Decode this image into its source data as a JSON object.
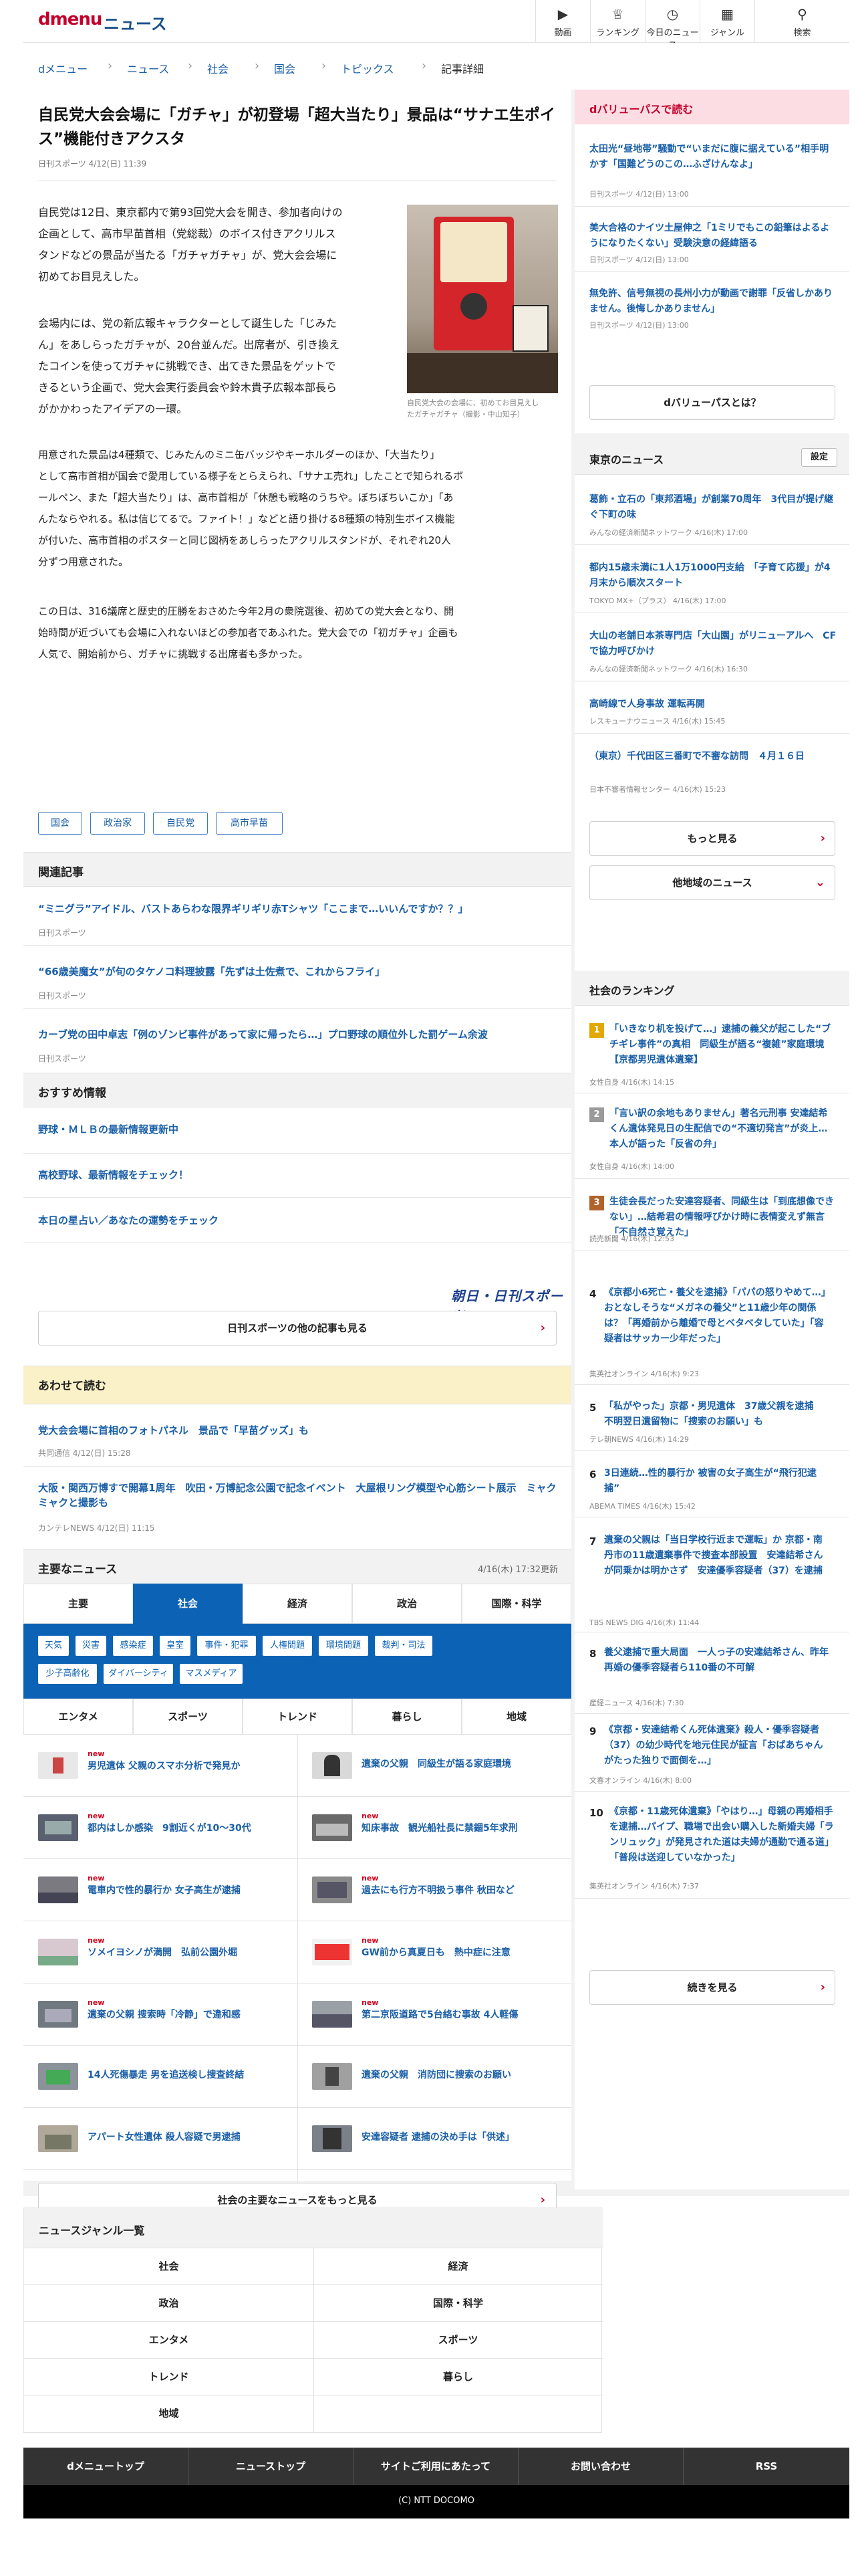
{
  "header": {
    "logo": "dmenu",
    "section": "ニュース",
    "nav": [
      {
        "icon": "video-icon",
        "label": "動画"
      },
      {
        "icon": "crown-icon",
        "label": "ランキング"
      },
      {
        "icon": "clock-icon",
        "label": "今日のニュース"
      },
      {
        "icon": "grid-icon",
        "label": "ジャンル"
      },
      {
        "icon": "search-icon",
        "label": "検索"
      }
    ]
  },
  "breadcrumb": [
    "dメニュー",
    "ニュース",
    "社会",
    "国会",
    "トピックス",
    "記事詳細"
  ],
  "article": {
    "title": "自民党大会会場に「ガチャ」が初登場「超大当たり」景品は“サナエ生ポイス”機能付きアクスタ",
    "meta": "日刊スポーツ 4/12(日) 11:39",
    "paragraphs": [
      [
        "自民党は12日、東京都内で第93回党大会を開き、参加者向けの",
        "企画として、高市早苗首相（党総裁）のボイス付きアクリルス",
        "タンドなどの景品が当たる「ガチャガチャ」が、党大会会場に",
        "初めてお目見えした。"
      ],
      [
        "会場内には、党の新広報キャラクターとして誕生した「じみた",
        "ん」をあしらったガチャが、20台並んだ。出席者が、引き換え",
        "たコインを使ってガチャに挑戦でき、出てきた景品をゲットで",
        "きるという企画で、党大会実行委員会や鈴木貴子広報本部長ら",
        "がかかわったアイデアの一環。"
      ],
      [
        "用意された景品は4種類で、じみたんのミニ缶バッジやキーホルダーのほか、「大当たり」",
        "として高市首相が国会で愛用している様子をとらえられ、「サナエ売れ」したことで知られるボ",
        "ールペン、また「超大当たり」は、高市首相が「休憩も戦略のうちや。ぼちぼちいこか」「あ",
        "んたならやれる。私は信じてるで。ファイト！」などと語り掛ける8種類の特別生ボイス機能",
        "が付いた、高市首相のポスターと同じ図柄をあしらったアクリルスタンドが、それぞれ20人",
        "分ずつ用意された。"
      ],
      [
        "この日は、316議席と歴史的圧勝をおさめた今年2月の衆院選後、初めての党大会となり、開",
        "始時間が近づいても会場に入れないほどの参加者であふれた。党大会での「初ガチャ」企画も",
        "人気で、開始前から、ガチャに挑戦する出席者も多かった。"
      ]
    ],
    "photo_caption": [
      "自民党大会の会場に、初めてお目見えし",
      "たガチャガチャ（撮影・中山知子）"
    ],
    "tags": [
      "国会",
      "政治家",
      "自民党",
      "高市早苗"
    ]
  },
  "related": {
    "heading": "関連記事",
    "items": [
      {
        "title": "“ミニグラ”アイドル、バストあらわな限界ギリギリ赤Tシャツ「ここまで…いいんですか？？」",
        "source": "日刊スポーツ"
      },
      {
        "title": "“66歳美魔女”が旬のタケノコ料理披露「先ずは土佐煮で、これからフライ」",
        "source": "日刊スポーツ"
      },
      {
        "title": "カーブ党の田中卓志「例のゾンビ事件があって家に帰ったら…」プロ野球の順位外した罰ゲーム余波",
        "source": "日刊スポーツ"
      }
    ]
  },
  "recommended": {
    "heading": "おすすめ情報",
    "items": [
      "野球・ＭＬＢの最新情報更新中",
      "高校野球、最新情報をチェック！",
      "本日の星占い／あなたの運勢をチェック"
    ],
    "brand": "朝日・日刊スポーツ",
    "more_button": "日刊スポーツの他の記事も見る"
  },
  "also_read": {
    "heading": "あわせて読む",
    "items": [
      {
        "title": "党大会会場に首相のフォトパネル　景品で「早苗グッズ」も",
        "source": "共同通信 4/12(日) 15:28"
      },
      {
        "title": "大阪・関西万博すで開幕1周年　吹田・万博記念公園で記念イベント　大屋根リング模型や心筋シート展示　ミャクミャクと撮影も",
        "source": "カンテレNEWS 4/12(日) 11:15"
      }
    ]
  },
  "major_news": {
    "heading": "主要なニュース",
    "datetime": "4/16(木) 17:32更新",
    "tabs": [
      "主要",
      "社会",
      "経済",
      "政治",
      "国際・科学"
    ],
    "subcats": [
      "天気",
      "災害",
      "感染症",
      "皇室",
      "事件・犯罪",
      "人権問題",
      "環境問題",
      "裁判・司法",
      "少子高齢化",
      "ダイバーシティ",
      "マスメディア"
    ],
    "tabs2": [
      "エンタメ",
      "スポーツ",
      "トレンド",
      "暮らし",
      "地域"
    ],
    "new_label": "new",
    "items": [
      "男児遺体 父親のスマホ分析で発見か",
      "遺棄の父親　同級生が語る家庭環境",
      "都内はしか感染　9割近くが10～30代",
      "知床事故　観光船社長に禁錮5年求刑",
      "電車内で性的暴行か 女子高生が逮捕",
      "過去にも行方不明扱う事件 秋田など",
      "ソメイヨシノが満開　弘前公園外堀",
      "GW前から真夏日も　熱中症に注意",
      "遺棄の父親 捜索時「冷静」で違和感",
      "第二京阪道路で5台絡む事故 4人軽傷",
      "14人死傷暴走 男を追送検し捜査終結",
      "遺棄の父親　消防団に捜索のお願い",
      "アパート女性遺体 殺人容疑で男逮捕",
      "安達容疑者 逮捕の決め手は「供述」"
    ],
    "more_button": "社会の主要なニュースをもっと見る"
  },
  "sidebar": {
    "dvalue": {
      "heading": "dバリューパスで読む",
      "items": [
        {
          "title": "太田光“昼地帯”騒動で“いまだに腹に据えている”相手明かす「国難どうのこの…ふざけんなよ」",
          "source": "日刊スポーツ 4/12(日) 13:00"
        },
        {
          "title": "美大合格のナイツ土屋伸之「1ミリでもこの鉛筆はよるようになりたくない」受験決意の経緯語る",
          "source": "日刊スポーツ 4/12(日) 13:00"
        },
        {
          "title": "無免許、信号無視の長州小力が動画で謝罪「反省しかありません。後悔しかありません」",
          "source": "日刊スポーツ 4/12(日) 13:00"
        }
      ],
      "button": "dバリューパスとは？"
    },
    "tokyo": {
      "heading": "東京のニュース",
      "settings": "設定",
      "items": [
        {
          "title": "葛飾・立石の「東邦酒場」が創業70周年　3代目が提げ継ぐ下町の味",
          "source": "みんなの経済新聞ネットワーク 4/16(木) 17:00"
        },
        {
          "title": "都内15歳未満に1人1万1000円支給　「子育て応援」が4月末から順次スタート",
          "source": "TOKYO MX+（プラス） 4/16(木) 17:00"
        },
        {
          "title": "大山の老舗日本茶専門店「大山園」がリニューアルへ　CFで協力呼びかけ",
          "source": "みんなの経済新聞ネットワーク 4/16(木) 16:30"
        },
        {
          "title": "高崎線で人身事故 運転再開",
          "source": "レスキューナウニュース 4/16(木) 15:45"
        },
        {
          "title": "（東京）千代田区三番町で不審な訪問　４月１６日",
          "source": "日本不審者情報センター 4/16(木) 15:23"
        }
      ],
      "more_button": "もっと見る",
      "region_button": "他地域のニュース"
    },
    "ranking": {
      "heading": "社会のランキング",
      "items": [
        {
          "num": "1",
          "title": "「いきなり机を投げて…」逮捕の義父が起こした“ブチギレ事件”の真相　同級生が語る“複雑”家庭環境【京都男児遺体遺棄】",
          "source": "女性自身 4/16(木) 14:15"
        },
        {
          "num": "2",
          "title": "「言い訳の余地もありません」著名元刑事 安達結希くん遺体発見日の生配信での“不適切発言”が炎上…本人が語った「反省の弁」",
          "source": "女性自身 4/16(木) 14:00"
        },
        {
          "num": "3",
          "title": "生徒会長だった安達容疑者、同級生は「到底想像できない」…結希君の情報呼びかけ時に表情変えず無言「不自然さ覚えた」",
          "source": "読売新聞 4/16(木) 12:53"
        },
        {
          "num": "4",
          "title": "《京都小6死亡・養父を逮捕》「パパの怒りやめて…」おとなしそうな“メガネの養父”と11歳少年の関係は？「再婚前から離婚で母とベタベタしていた」「容疑者はサッカー少年だった」",
          "source": "集英社オンライン 4/16(木) 9:23"
        },
        {
          "num": "5",
          "title": "「私がやった」京都・男児遺体　37歳父親を逮捕　不明翌日遺留物に「捜索のお願い」も",
          "source": "テレ朝NEWS 4/16(木) 14:29"
        },
        {
          "num": "6",
          "title": "3日連続…性的暴行か 被害の女子高生が“飛行犯逮捕”",
          "source": "ABEMA TIMES 4/16(木) 15:42"
        },
        {
          "num": "7",
          "title": "遺棄の父親は「当日学校行近まで運転」か 京都・南丹市の11歳遺棄事件で捜査本部設置　安達結希さんが同乗かは明かさず　安達優季容疑者（37）を逮捕",
          "source": "TBS NEWS DIG 4/16(木) 11:44"
        },
        {
          "num": "8",
          "title": "養父逮捕で重大局面　一人っ子の安達結希さん、昨年再婚の優季容疑者ら110番の不可解",
          "source": "産経ニュース 4/16(木) 7:30"
        },
        {
          "num": "9",
          "title": "《京都・安達結希くん死体遺棄》殺人・優季容疑者（37）の幼少時代を地元住民が証言「おばあちゃんがたった独りで面倒を…」",
          "source": "文春オンライン 4/16(木) 8:00"
        },
        {
          "num": "10",
          "title": "《京都・11歳死体遺棄》「やはり…」母親の再婚相手を逮捕…パイプ、職場で出会い購入した新婚夫婦「ランリュック」が発見された道は夫婦が通勤で通る道」「普段は送迎していなかった」",
          "source": "集英社オンライン 4/16(木) 7:37"
        }
      ],
      "more_button": "続きを見る"
    }
  },
  "genres": {
    "heading": "ニュースジャンル一覧",
    "items": [
      "社会",
      "経済",
      "政治",
      "国際・科学",
      "エンタメ",
      "スポーツ",
      "トレンド",
      "暮らし",
      "地域"
    ]
  },
  "footer": {
    "nav": [
      "dメニュートップ",
      "ニューストップ",
      "サイトご利用にあたって",
      "お問い合わせ",
      "RSS"
    ],
    "copyright": "(C) NTT DOCOMO"
  }
}
